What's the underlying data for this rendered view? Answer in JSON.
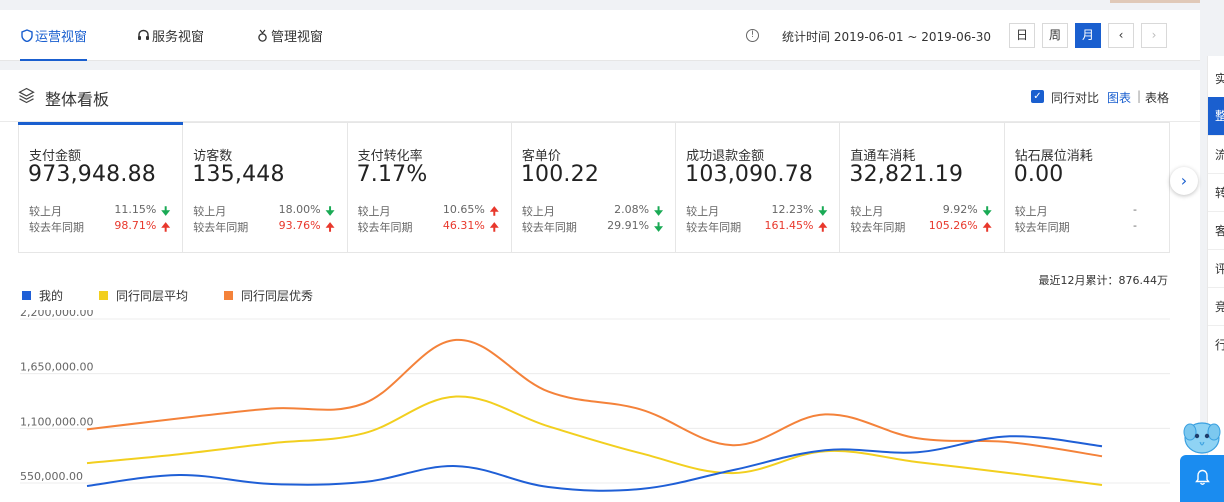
{
  "header": {
    "tabs": [
      {
        "label": "运营视窗",
        "icon": "shield-icon",
        "active": true
      },
      {
        "label": "服务视窗",
        "icon": "headset-icon",
        "active": false
      },
      {
        "label": "管理视窗",
        "icon": "medal-icon",
        "active": false
      }
    ],
    "stat_time": "统计时间 2019-06-01 ~ 2019-06-30",
    "periods": [
      {
        "label": "日",
        "selected": false
      },
      {
        "label": "周",
        "selected": false
      },
      {
        "label": "月",
        "selected": true
      }
    ],
    "prev_icon": "chevron-left-icon",
    "next_icon": "chevron-right-icon"
  },
  "panel": {
    "title": "整体看板",
    "peer_compare_label": "同行对比",
    "view_chart": "图表",
    "view_sep": "|",
    "view_table": "表格",
    "cumulative": "最近12月累计：876.44万"
  },
  "metrics": [
    {
      "name": "支付金额",
      "value": "973,948.88",
      "mom_label": "较上月",
      "mom": "11.15%",
      "mom_dir": "down",
      "yoy_label": "较去年同期",
      "yoy": "98.71%",
      "yoy_dir": "up"
    },
    {
      "name": "访客数",
      "value": "135,448",
      "mom_label": "较上月",
      "mom": "18.00%",
      "mom_dir": "down",
      "yoy_label": "较去年同期",
      "yoy": "93.76%",
      "yoy_dir": "up"
    },
    {
      "name": "支付转化率",
      "value": "7.17%",
      "mom_label": "较上月",
      "mom": "10.65%",
      "mom_dir": "up",
      "yoy_label": "较去年同期",
      "yoy": "46.31%",
      "yoy_dir": "up"
    },
    {
      "name": "客单价",
      "value": "100.22",
      "mom_label": "较上月",
      "mom": "2.08%",
      "mom_dir": "down",
      "yoy_label": "较去年同期",
      "yoy": "29.91%",
      "yoy_dir": "down"
    },
    {
      "name": "成功退款金额",
      "value": "103,090.78",
      "mom_label": "较上月",
      "mom": "12.23%",
      "mom_dir": "down",
      "yoy_label": "较去年同期",
      "yoy": "161.45%",
      "yoy_dir": "up"
    },
    {
      "name": "直通车消耗",
      "value": "32,821.19",
      "mom_label": "较上月",
      "mom": "9.92%",
      "mom_dir": "down",
      "yoy_label": "较去年同期",
      "yoy": "105.26%",
      "yoy_dir": "up"
    },
    {
      "name": "钻石展位消耗",
      "value": "0.00",
      "mom_label": "较上月",
      "mom": "-",
      "mom_dir": "none",
      "yoy_label": "较去年同期",
      "yoy": "-",
      "yoy_dir": "none"
    }
  ],
  "sidenav": [
    "实",
    "整",
    "流",
    "转",
    "客",
    "评",
    "竞",
    "行"
  ],
  "chart_data": {
    "type": "line",
    "title": "",
    "xlabel": "",
    "ylabel": "",
    "ylim": [
      550000,
      2200000
    ],
    "yticks": [
      "2,200,000.00",
      "1,650,000.00",
      "1,100,000.00",
      "550,000.00"
    ],
    "ytick_values": [
      2200000,
      1650000,
      1100000,
      550000
    ],
    "grid": true,
    "legend_position": "top-left",
    "x": [
      1,
      2,
      3,
      4,
      5,
      6,
      7,
      8,
      9,
      10,
      11,
      12
    ],
    "series": [
      {
        "name": "我的",
        "color": "#1f5fd6",
        "values": [
          520000,
          630000,
          540000,
          560000,
          720000,
          510000,
          490000,
          680000,
          880000,
          860000,
          1020000,
          920000
        ]
      },
      {
        "name": "同行同层平均",
        "color": "#f2cf1f",
        "values": [
          750000,
          840000,
          950000,
          1050000,
          1420000,
          1120000,
          850000,
          650000,
          870000,
          760000,
          650000,
          530000
        ]
      },
      {
        "name": "同行同层优秀",
        "color": "#f4823a",
        "values": [
          1090000,
          1200000,
          1300000,
          1350000,
          1990000,
          1470000,
          1290000,
          930000,
          1240000,
          1000000,
          960000,
          820000
        ]
      }
    ]
  }
}
